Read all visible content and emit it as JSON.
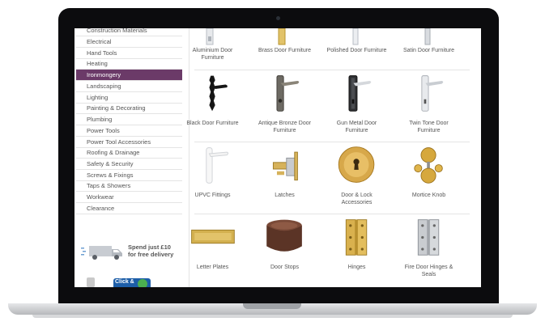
{
  "sidebar": {
    "items": [
      {
        "label": "Construction Materials",
        "active": false
      },
      {
        "label": "Electrical",
        "active": false
      },
      {
        "label": "Hand Tools",
        "active": false
      },
      {
        "label": "Heating",
        "active": false
      },
      {
        "label": "Ironmongery",
        "active": true
      },
      {
        "label": "Landscaping",
        "active": false
      },
      {
        "label": "Lighting",
        "active": false
      },
      {
        "label": "Painting & Decorating",
        "active": false
      },
      {
        "label": "Plumbing",
        "active": false
      },
      {
        "label": "Power Tools",
        "active": false
      },
      {
        "label": "Power Tool Accessories",
        "active": false
      },
      {
        "label": "Roofing & Drainage",
        "active": false
      },
      {
        "label": "Safety & Security",
        "active": false
      },
      {
        "label": "Screws & Fixings",
        "active": false
      },
      {
        "label": "Taps & Showers",
        "active": false
      },
      {
        "label": "Workwear",
        "active": false
      },
      {
        "label": "Clearance",
        "active": false
      }
    ]
  },
  "delivery": {
    "line1": "Spend just £10",
    "line2": "for free delivery"
  },
  "badge": {
    "text": "Click &"
  },
  "products": [
    [
      {
        "label1": "Aluminium Door",
        "label2": "Furniture",
        "icon": "aluminium-handle-icon"
      },
      {
        "label1": "Brass Door Furniture",
        "label2": "",
        "icon": "brass-handle-icon"
      },
      {
        "label1": "Polished Door Furniture",
        "label2": "",
        "icon": "polished-handle-icon"
      },
      {
        "label1": "Satin Door Furniture",
        "label2": "",
        "icon": "satin-handle-icon"
      }
    ],
    [
      {
        "label1": "Black Door Furniture",
        "label2": "",
        "icon": "black-handle-icon"
      },
      {
        "label1": "Antique Bronze Door",
        "label2": "Furniture",
        "icon": "bronze-handle-icon"
      },
      {
        "label1": "Gun Metal Door",
        "label2": "Furniture",
        "icon": "gunmetal-handle-icon"
      },
      {
        "label1": "Twin Tone Door",
        "label2": "Furniture",
        "icon": "twintone-handle-icon"
      }
    ],
    [
      {
        "label1": "UPVC Fittings",
        "label2": "",
        "icon": "upvc-handle-icon"
      },
      {
        "label1": "Latches",
        "label2": "",
        "icon": "latch-icon"
      },
      {
        "label1": "Door & Lock",
        "label2": "Accessories",
        "icon": "escutcheon-icon"
      },
      {
        "label1": "Mortice Knob",
        "label2": "",
        "icon": "mortice-knob-icon"
      }
    ],
    [
      {
        "label1": "Letter Plates",
        "label2": "",
        "icon": "letter-plate-icon"
      },
      {
        "label1": "Door Stops",
        "label2": "",
        "icon": "door-stop-icon"
      },
      {
        "label1": "Hinges",
        "label2": "",
        "icon": "brass-hinge-icon"
      },
      {
        "label1": "Fire Door Hinges &",
        "label2": "Seals",
        "icon": "fire-hinge-icon"
      }
    ]
  ]
}
